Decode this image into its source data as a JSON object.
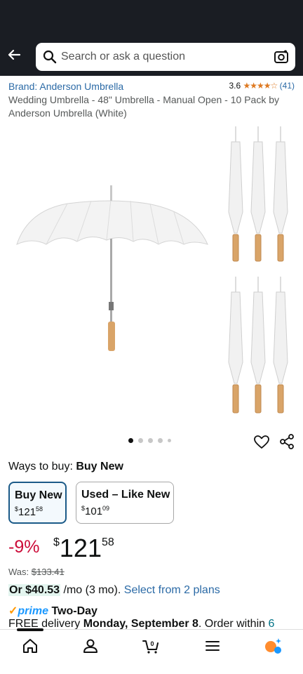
{
  "search": {
    "placeholder": "Search or ask a question"
  },
  "product": {
    "brand": "Brand: Anderson Umbrella",
    "rating_value": "3.6",
    "rating_stars": "★★★★☆",
    "rating_count": "(41)",
    "title": "Wedding Umbrella - 48\" Umbrella - Manual Open - 10 Pack by Anderson Umbrella (White)"
  },
  "ways_to_buy": {
    "label": "Ways to buy:",
    "selected": "Buy New"
  },
  "options": [
    {
      "label": "Buy New",
      "dollars": "121",
      "cents": "58"
    },
    {
      "label": "Used – Like New",
      "dollars": "101",
      "cents": "09"
    }
  ],
  "price": {
    "discount": "-9%",
    "currency": "$",
    "dollars": "121",
    "cents": "58",
    "was_label": "Was:",
    "was_value": "$133.41"
  },
  "monthly": {
    "prefix": "Or",
    "amount": "$40.53",
    "term": "/mo (3 mo).",
    "link": "Select from 2 plans"
  },
  "delivery": {
    "prime_check": "✓",
    "prime_logo": "prime",
    "speed": "Two-Day",
    "text_prefix": "FREE delivery",
    "date": "Monday, September 8",
    "text_suffix": ". Order within",
    "countdown": "6"
  },
  "colors": {
    "link": "#2b6aa6",
    "deal": "#cc0c39",
    "header": "#1a1d23",
    "prime": "#1a98ff",
    "stars": "#de7921"
  }
}
